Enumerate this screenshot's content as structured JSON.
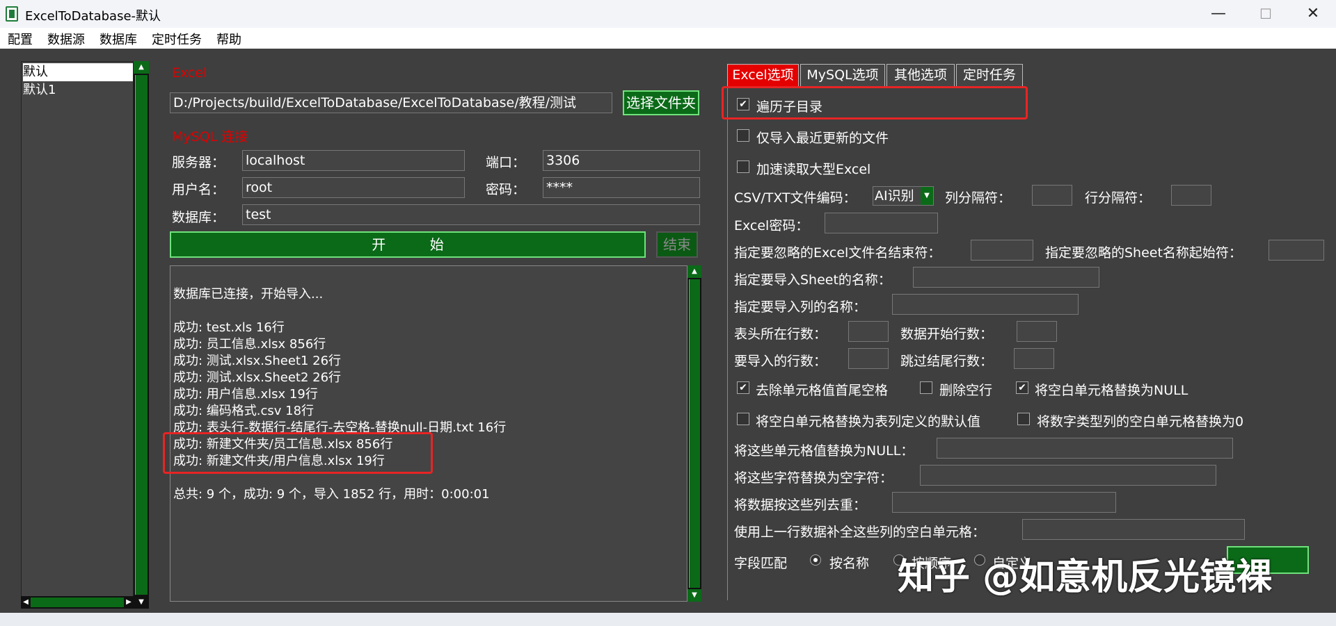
{
  "window": {
    "title": "ExcelToDatabase-默认",
    "minimize": "—",
    "maximize": "☐",
    "close": "✕"
  },
  "menu": [
    "配置",
    "数据源",
    "数据库",
    "定时任务",
    "帮助"
  ],
  "config_list": [
    "默认",
    "默认1"
  ],
  "excel": {
    "section": "Excel",
    "path": "D:/Projects/build/ExcelToDatabase/ExcelToDatabase/教程/测试",
    "choose_folder": "选择文件夹"
  },
  "mysql": {
    "section": "MySQL 连接",
    "server_label": "服务器：",
    "server": "localhost",
    "port_label": "端口：",
    "port": "3306",
    "user_label": "用户名：",
    "user": "root",
    "password_label": "密码：",
    "password": "****",
    "database_label": "数据库：",
    "database": "test"
  },
  "actions": {
    "start": "开          始",
    "stop": "结束"
  },
  "log": [
    "数据库已连接，开始导入...",
    "",
    "成功: test.xls 16行",
    "成功: 员工信息.xlsx 856行",
    "成功: 测试.xlsx.Sheet1 26行",
    "成功: 测试.xlsx.Sheet2 26行",
    "成功: 用户信息.xlsx 19行",
    "成功: 编码格式.csv 18行",
    "成功: 表头行-数据行-结尾行-去空格-替换null-日期.txt 16行",
    "成功: 新建文件夹/员工信息.xlsx 856行",
    "成功: 新建文件夹/用户信息.xlsx 19行",
    "",
    "总共: 9 个，成功: 9 个，导入 1852 行，用时：0:00:01"
  ],
  "tabs": [
    "Excel选项",
    "MySQL选项",
    "其他选项",
    "定时任务"
  ],
  "options": {
    "traverse_subdirs": "遍历子目录",
    "import_recent_only": "仅导入最近更新的文件",
    "speed_large_excel": "加速读取大型Excel",
    "csv_encoding_label": "CSV/TXT文件编码：",
    "csv_encoding_value": "AI识别",
    "col_sep_label": "列分隔符：",
    "row_sep_label": "行分隔符：",
    "excel_password_label": "Excel密码：",
    "ignore_file_suffix_label": "指定要忽略的Excel文件名结束符：",
    "ignore_sheet_prefix_label": "指定要忽略的Sheet名称起始符：",
    "sheet_names_label": "指定要导入Sheet的名称：",
    "column_names_label": "指定要导入列的名称：",
    "header_row_label": "表头所在行数：",
    "data_start_label": "数据开始行数：",
    "rows_to_import_label": "要导入的行数：",
    "skip_tail_label": "跳过结尾行数：",
    "trim_spaces": "去除单元格值首尾空格",
    "delete_empty_rows": "删除空行",
    "blank_to_null": "将空白单元格替换为NULL",
    "blank_to_default": "将空白单元格替换为表列定义的默认值",
    "numeric_blank_to_zero": "将数字类型列的空白单元格替换为0",
    "values_to_null_label": "将这些单元格值替换为NULL：",
    "chars_to_empty_label": "将这些字符替换为空字符：",
    "dedupe_label": "将数据按这些列去重：",
    "fill_from_prev_label": "使用上一行数据补全这些列的空白单元格：",
    "field_match_label": "字段匹配",
    "match_by_name": "按名称",
    "match_by_order": "按顺序",
    "match_custom": "自定义"
  },
  "watermark": "知乎 @如意机反光镜裸"
}
